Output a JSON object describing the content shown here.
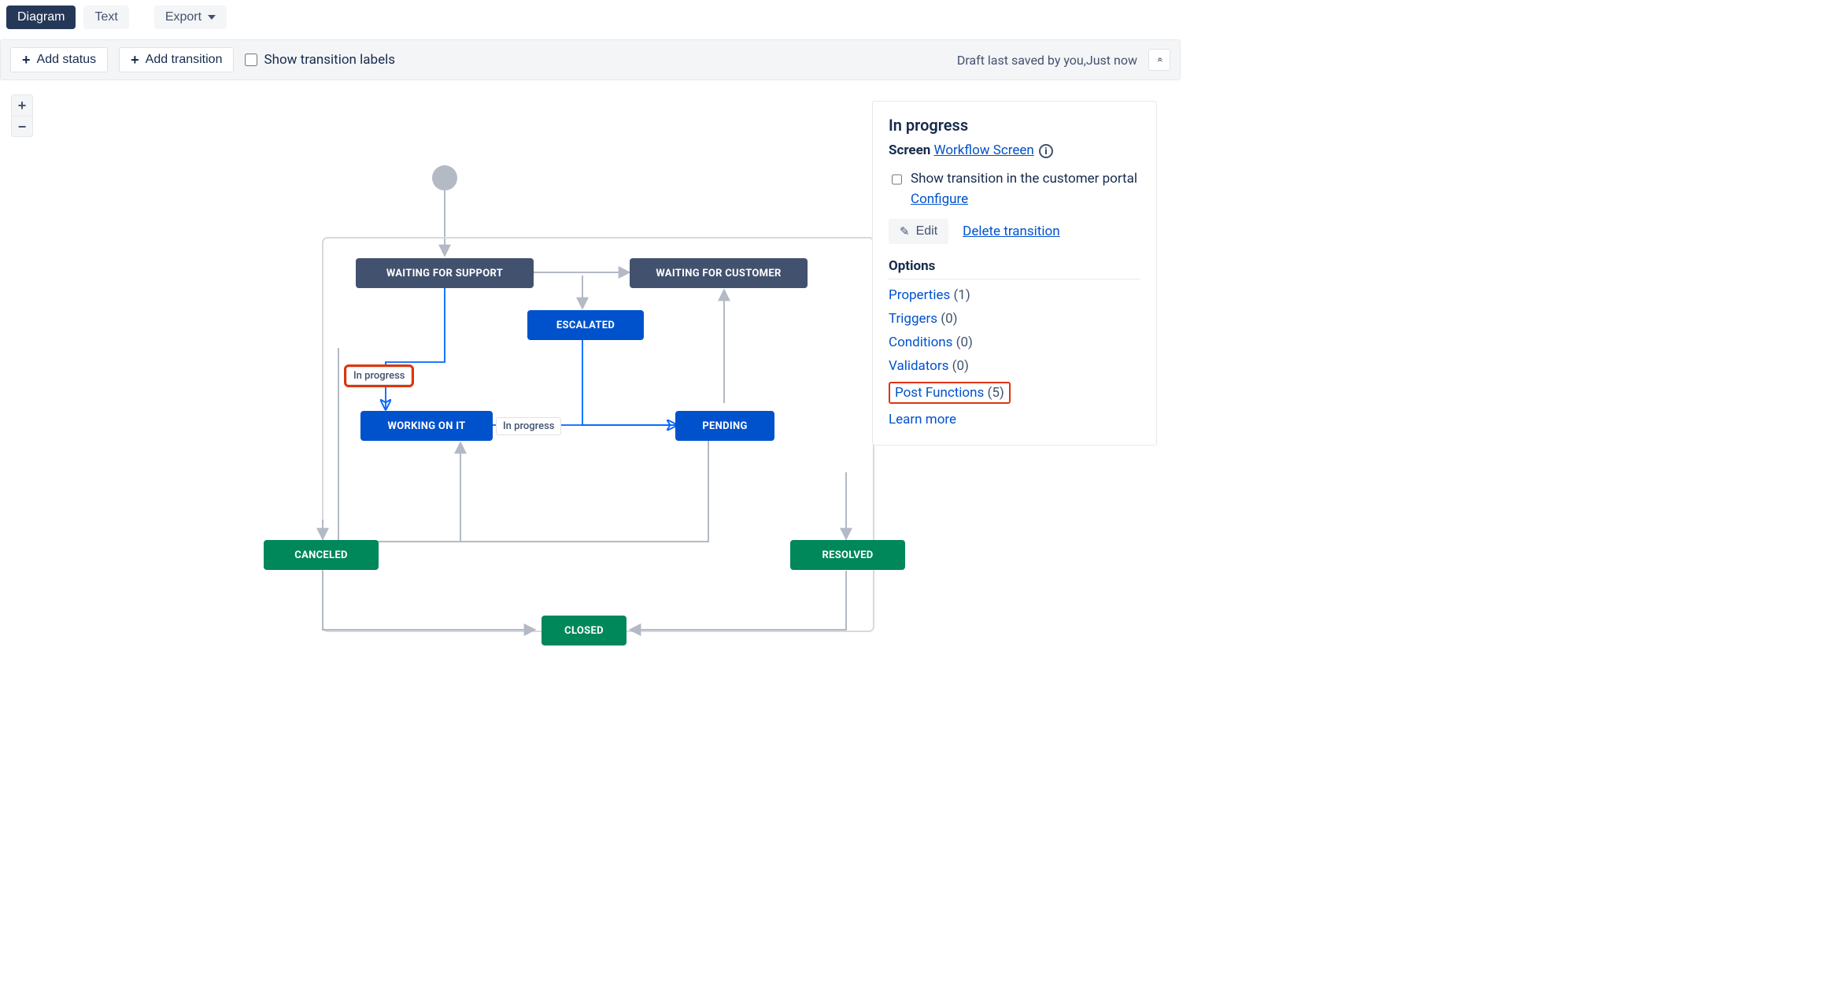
{
  "tabs": {
    "diagram": "Diagram",
    "text": "Text",
    "export": "Export"
  },
  "toolbar": {
    "add_status": "Add status",
    "add_transition": "Add transition",
    "show_labels": "Show transition labels",
    "draft_saved": "Draft last saved by you,Just now"
  },
  "zoom": {
    "in": "+",
    "out": "−"
  },
  "nodes": {
    "waiting_support": "WAITING FOR SUPPORT",
    "waiting_customer": "WAITING FOR CUSTOMER",
    "escalated": "ESCALATED",
    "working_on_it": "WORKING ON IT",
    "pending": "PENDING",
    "canceled": "CANCELED",
    "resolved": "RESOLVED",
    "closed": "CLOSED"
  },
  "transition_labels": {
    "in_progress_1": "In progress",
    "in_progress_2": "In progress"
  },
  "panel": {
    "title": "In progress",
    "screen_label": "Screen",
    "screen_link": "Workflow Screen",
    "show_portal": "Show transition in the customer portal",
    "configure": "Configure",
    "edit": "Edit",
    "delete": "Delete transition",
    "options_head": "Options",
    "properties": "Properties",
    "properties_count": "(1)",
    "triggers": "Triggers",
    "triggers_count": "(0)",
    "conditions": "Conditions",
    "conditions_count": "(0)",
    "validators": "Validators",
    "validators_count": "(0)",
    "post_functions": "Post Functions",
    "post_functions_count": "(5)",
    "learn_more": "Learn more"
  }
}
